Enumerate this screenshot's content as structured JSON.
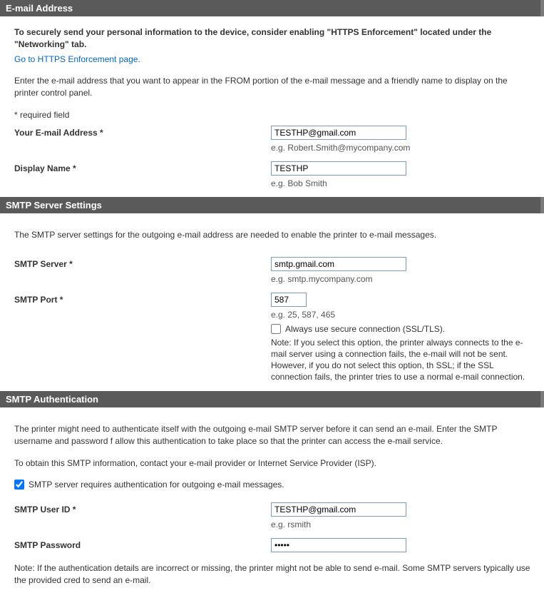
{
  "email_section": {
    "header": "E-mail Address",
    "intro_bold": "To securely send your personal information to the device, consider enabling \"HTTPS Enforcement\" located under the \"Networking\" tab.",
    "https_link": "Go to HTTPS Enforcement page.",
    "desc": "Enter the e-mail address that you want to appear in the FROM portion of the e-mail message and a friendly name to display on the printer control panel.",
    "required_note": "* required field",
    "email_label": "Your E-mail Address *",
    "email_value": "TESTHP@gmail.com",
    "email_hint": "e.g. Robert.Smith@mycompany.com",
    "display_label": "Display Name *",
    "display_value": "TESTHP",
    "display_hint": "e.g. Bob Smith"
  },
  "smtp_section": {
    "header": "SMTP Server Settings",
    "desc": "The SMTP server settings for the outgoing e-mail address are needed to enable the printer to e-mail messages.",
    "server_label": "SMTP Server *",
    "server_value": "smtp.gmail.com",
    "server_hint": "e.g. smtp.mycompany.com",
    "port_label": "SMTP Port *",
    "port_value": "587",
    "port_hint": "e.g. 25, 587, 465",
    "ssl_checkbox_label": "Always use secure connection (SSL/TLS).",
    "ssl_note": "Note: If you select this option, the printer always connects to the e-mail server using a connection fails, the e-mail will not be sent. However, if you do not select this option, th SSL; if the SSL connection fails, the printer tries to use a normal e-mail connection."
  },
  "auth_section": {
    "header": "SMTP Authentication",
    "desc1": "The printer might need to authenticate itself with the outgoing e-mail SMTP server before it can send an e-mail. Enter the SMTP username and password f allow this authentication to take place so that the printer can access the e-mail service.",
    "desc2": "To obtain this SMTP information, contact your e-mail provider or Internet Service Provider (ISP).",
    "auth_checkbox_label": "SMTP server requires authentication for outgoing e-mail messages.",
    "user_label": "SMTP User ID *",
    "user_value": "TESTHP@gmail.com",
    "user_hint": "e.g. rsmith",
    "pass_label": "SMTP Password",
    "pass_value": "•••••",
    "footer_note": "Note: If the authentication details are incorrect or missing, the printer might not be able to send e-mail. Some SMTP servers typically use the provided cred to send an e-mail."
  }
}
